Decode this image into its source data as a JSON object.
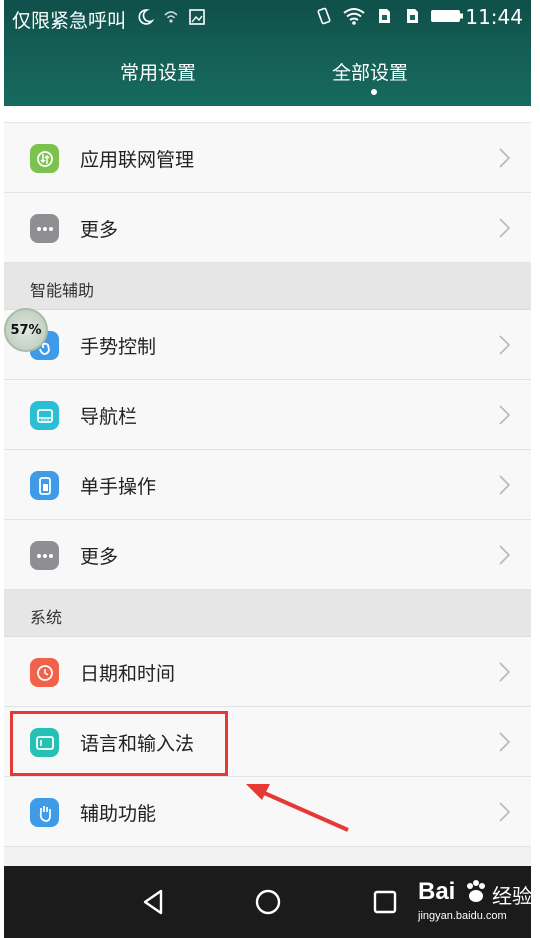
{
  "status_bar": {
    "left_text": "仅限紧急呼叫",
    "time": "11:44"
  },
  "tabs": [
    {
      "label": "常用设置"
    },
    {
      "label": "全部设置"
    }
  ],
  "sections": {
    "top_items": [
      {
        "label": "应用联网管理",
        "icon": "network-sync-icon",
        "color": "#7cc24e"
      },
      {
        "label": "更多",
        "icon": "more-dots-icon",
        "color": "#8e8e93"
      }
    ],
    "smart_assist": {
      "title": "智能辅助",
      "items": [
        {
          "label": "手势控制",
          "icon": "gesture-hand-icon",
          "color": "#3f9be8"
        },
        {
          "label": "导航栏",
          "icon": "navigation-bar-icon",
          "color": "#2bbfd6"
        },
        {
          "label": "单手操作",
          "icon": "one-hand-icon",
          "color": "#3f9be8"
        },
        {
          "label": "更多",
          "icon": "more-dots-icon",
          "color": "#8e8e93"
        }
      ]
    },
    "system": {
      "title": "系统",
      "items": [
        {
          "label": "日期和时间",
          "icon": "clock-icon",
          "color": "#f0634a"
        },
        {
          "label": "语言和输入法",
          "icon": "keyboard-icon",
          "color": "#26c1b5"
        },
        {
          "label": "辅助功能",
          "icon": "hand-icon",
          "color": "#3f9be8"
        }
      ]
    }
  },
  "overlay": {
    "progress_badge": "57%"
  },
  "watermark": {
    "logo": "Bai",
    "brand": "经验",
    "url": "jingyan.baidu.com"
  }
}
